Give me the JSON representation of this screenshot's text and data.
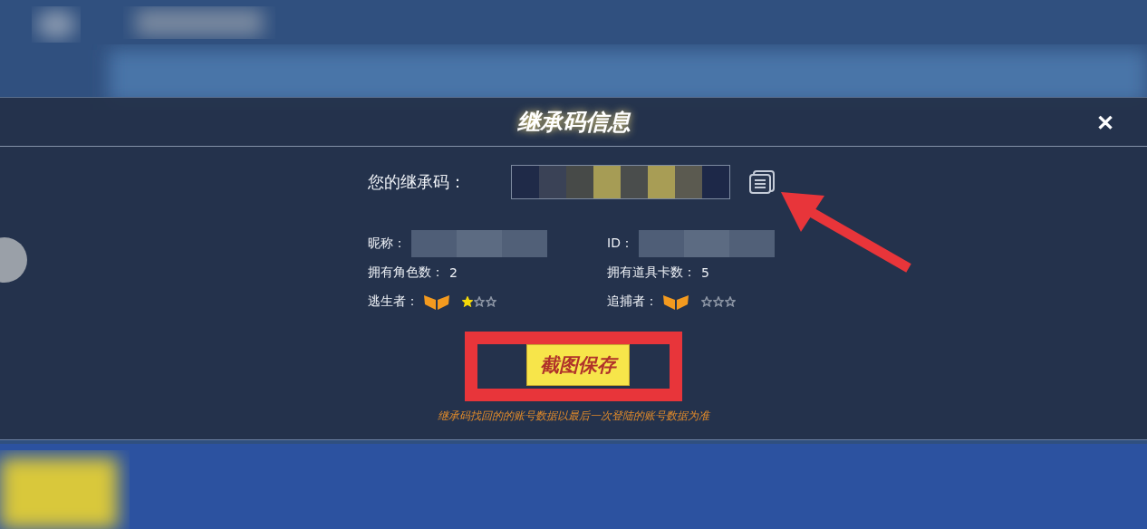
{
  "dialog": {
    "title": "继承码信息",
    "close": "✕",
    "code_label": "您的继承码：",
    "info_left": [
      {
        "kind": "text",
        "label": "昵称："
      },
      {
        "kind": "text",
        "label": "拥有角色数：",
        "value": "2"
      },
      {
        "kind": "rank",
        "label": "逃生者：",
        "stars": 1
      }
    ],
    "info_right": [
      {
        "kind": "text",
        "label": "ID："
      },
      {
        "kind": "text",
        "label": "拥有道具卡数：",
        "value": "5"
      },
      {
        "kind": "rank",
        "label": "追捕者：",
        "stars": 0
      }
    ],
    "save_button": "截图保存",
    "note": "继承码找回的的账号数据以最后一次登陆的账号数据为准"
  }
}
